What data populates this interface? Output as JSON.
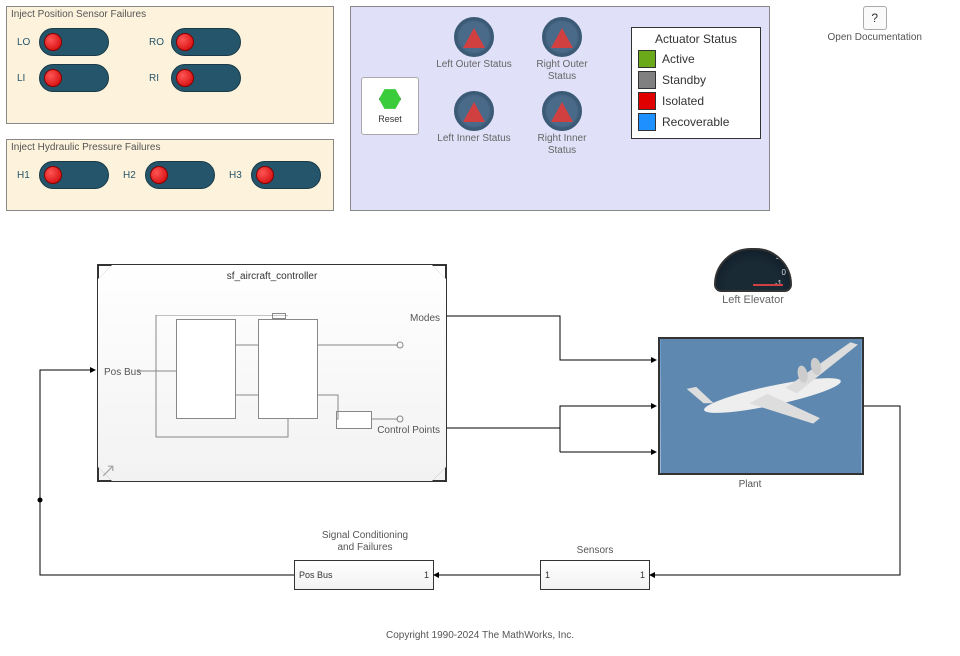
{
  "sensor_panel": {
    "title": "Inject Position Sensor Failures",
    "switches": [
      {
        "label": "LO"
      },
      {
        "label": "RO"
      },
      {
        "label": "LI"
      },
      {
        "label": "RI"
      }
    ]
  },
  "hydraulic_panel": {
    "title": "Inject Hydraulic Pressure Failures",
    "switches": [
      {
        "label": "H1"
      },
      {
        "label": "H2"
      },
      {
        "label": "H3"
      }
    ]
  },
  "status_panel": {
    "reset_label": "Reset",
    "gauges": [
      {
        "label": "Left Outer Status"
      },
      {
        "label": "Right Outer Status"
      },
      {
        "label": "Left Inner Status"
      },
      {
        "label": "Right Inner Status"
      }
    ],
    "legend": {
      "title": "Actuator Status",
      "items": [
        {
          "color": "#6aaa1a",
          "label": "Active"
        },
        {
          "color": "#808080",
          "label": "Standby"
        },
        {
          "color": "#e00000",
          "label": "Isolated"
        },
        {
          "color": "#1e90ff",
          "label": "Recoverable"
        }
      ]
    }
  },
  "help": {
    "symbol": "?",
    "label": "Open Documentation"
  },
  "controller": {
    "title": "sf_aircraft_controller",
    "in_port": "Pos Bus",
    "out_port1": "Modes",
    "out_port2": "Control Points"
  },
  "elevator": {
    "label": "Left Elevator",
    "ticks": {
      "top": "1",
      "mid": "0",
      "bot": "-1"
    }
  },
  "plant": {
    "label": "Plant"
  },
  "sc_block": {
    "above": "Signal Conditioning\nand Failures",
    "left": "Pos Bus",
    "right": "1"
  },
  "sensors_block": {
    "above": "Sensors",
    "left": "1",
    "right": "1"
  },
  "copyright": "Copyright 1990-2024 The MathWorks, Inc."
}
